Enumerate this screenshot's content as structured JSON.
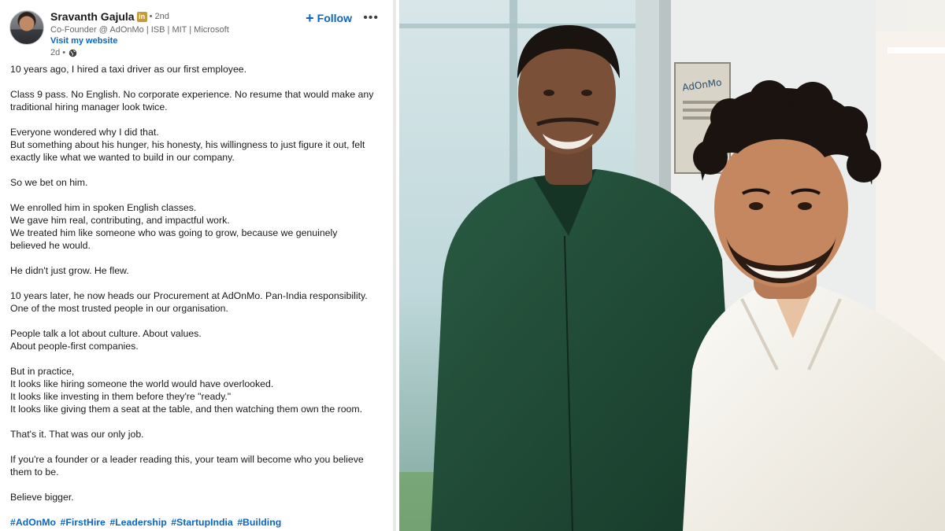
{
  "author": {
    "name": "Sravanth Gajula",
    "badge": "in",
    "degree": "• 2nd",
    "headline": "Co-Founder @ AdOnMo | ISB | MIT | Microsoft",
    "website": "Visit my website",
    "time": "2d •"
  },
  "actions": {
    "follow_label": "Follow",
    "more_label": "•••"
  },
  "post": {
    "paragraphs": [
      [
        "10 years ago, I hired a taxi driver as our first employee."
      ],
      [
        "Class 9 pass. No English. No corporate experience. No resume that would make any",
        "traditional hiring manager look twice."
      ],
      [
        "Everyone wondered why I did that.",
        "But something about his hunger, his honesty, his willingness to just figure it out, felt",
        "exactly like what we wanted to build in our company."
      ],
      [
        "So we bet on him."
      ],
      [
        "We enrolled him in spoken English classes.",
        "We gave him real, contributing, and impactful work.",
        "We treated him like someone who was going to grow, because we genuinely",
        "believed he would."
      ],
      [
        "He didn't just grow. He flew."
      ],
      [
        "10 years later, he now heads our Procurement at AdOnMo. Pan-India responsibility.",
        "One of the most trusted people in our organisation."
      ],
      [
        "People talk a lot about culture. About values.",
        "About people-first companies."
      ],
      [
        "But in practice,",
        "It looks like hiring someone the world would have overlooked.",
        "It looks like investing in them before they're \"ready.\"",
        "It looks like giving them a seat at the table, and then watching them own the room."
      ],
      [
        "That's it. That was our only job."
      ],
      [
        "If you're a founder or a leader reading this, your team will become who you believe",
        "them to be."
      ],
      [
        "Believe bigger."
      ]
    ],
    "hashtags": [
      "#AdOnMo",
      "#FirstHire",
      "#Leadership",
      "#StartupIndia",
      "#Building"
    ]
  },
  "photo": {
    "wall_sign": "AdOnMo",
    "colors": {
      "green_shirt": "#1f4a36",
      "white_shirt": "#f4f1ea",
      "wall": "#e4e7e7",
      "glass": "#c7dde0"
    }
  },
  "colors": {
    "link_blue": "#0a66c2",
    "text": "#191919",
    "muted": "#666666",
    "premium_gold": "#c69b3a"
  }
}
